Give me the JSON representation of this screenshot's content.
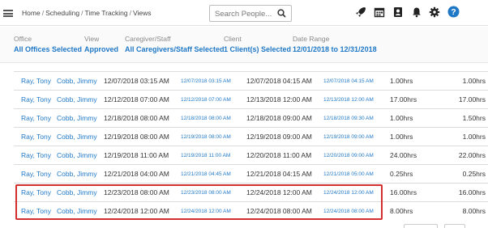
{
  "breadcrumb": [
    "Home",
    "Scheduling",
    "Time Tracking",
    "Views"
  ],
  "search": {
    "placeholder": "Search People..."
  },
  "toolbar_icons": [
    "rocket-icon",
    "calendar-icon",
    "contact-book-icon",
    "bell-icon",
    "gear-icon",
    "help-icon"
  ],
  "filters": [
    {
      "label": "Office",
      "value": "All Offices Selected"
    },
    {
      "label": "View",
      "value": "Approved"
    },
    {
      "label": "Caregiver/Staff",
      "value": "All Caregivers/Staff Selected"
    },
    {
      "label": "Client",
      "value": "1 Client(s) Selected"
    },
    {
      "label": "Date Range",
      "value": "12/01/2018 to 12/31/2018"
    }
  ],
  "rows": [
    {
      "client": "Ray, Tony",
      "caregiver": "Cobb, Jimmy",
      "sched_start": "12/07/2018 03:15 AM",
      "act_start": "12/07/2018 03:15 AM",
      "sched_end": "12/07/2018 04:15 AM",
      "act_end": "12/07/2018 04:15 AM",
      "sched_hours": "1.00hrs",
      "act_hours": "1.00hrs"
    },
    {
      "client": "Ray, Tony",
      "caregiver": "Cobb, Jimmy",
      "sched_start": "12/12/2018 07:00 AM",
      "act_start": "12/12/2018 07:00 AM",
      "sched_end": "12/13/2018 12:00 AM",
      "act_end": "12/13/2018 12:00 AM",
      "sched_hours": "17.00hrs",
      "act_hours": "17.00hrs"
    },
    {
      "client": "Ray, Tony",
      "caregiver": "Cobb, Jimmy",
      "sched_start": "12/18/2018 08:00 AM",
      "act_start": "12/18/2018 08:00 AM",
      "sched_end": "12/18/2018 09:00 AM",
      "act_end": "12/18/2018 09:30 AM",
      "sched_hours": "1.00hrs",
      "act_hours": "1.50hrs"
    },
    {
      "client": "Ray, Tony",
      "caregiver": "Cobb, Jimmy",
      "sched_start": "12/19/2018 08:00 AM",
      "act_start": "12/19/2018 08:00 AM",
      "sched_end": "12/19/2018 09:00 AM",
      "act_end": "12/19/2018 09:00 AM",
      "sched_hours": "1.00hrs",
      "act_hours": "1.00hrs"
    },
    {
      "client": "Ray, Tony",
      "caregiver": "Cobb, Jimmy",
      "sched_start": "12/19/2018 11:00 AM",
      "act_start": "12/19/2018 11:00 AM",
      "sched_end": "12/20/2018 11:00 AM",
      "act_end": "12/20/2018 09:00 AM",
      "sched_hours": "24.00hrs",
      "act_hours": "22.00hrs"
    },
    {
      "client": "Ray, Tony",
      "caregiver": "Cobb, Jimmy",
      "sched_start": "12/21/2018 04:00 AM",
      "act_start": "12/21/2018 04:45 AM",
      "sched_end": "12/21/2018 04:15 AM",
      "act_end": "12/21/2018 05:00 AM",
      "sched_hours": "0.25hrs",
      "act_hours": "0.25hrs"
    },
    {
      "client": "Ray, Tony",
      "caregiver": "Cobb, Jimmy",
      "sched_start": "12/23/2018 08:00 AM",
      "act_start": "12/23/2018 08:00 AM",
      "sched_end": "12/24/2018 12:00 AM",
      "act_end": "12/24/2018 12:00 AM",
      "sched_hours": "16.00hrs",
      "act_hours": "16.00hrs"
    },
    {
      "client": "Ray, Tony",
      "caregiver": "Cobb, Jimmy",
      "sched_start": "12/24/2018 12:00 AM",
      "act_start": "12/24/2018 12:00 AM",
      "sched_end": "12/24/2018 08:00 AM",
      "act_end": "12/24/2018 08:00 AM",
      "sched_hours": "8.00hrs",
      "act_hours": "8.00hrs"
    }
  ],
  "colors": {
    "link": "#1f78c6",
    "highlight": "#d32f2f",
    "help": "#1f78c6"
  }
}
